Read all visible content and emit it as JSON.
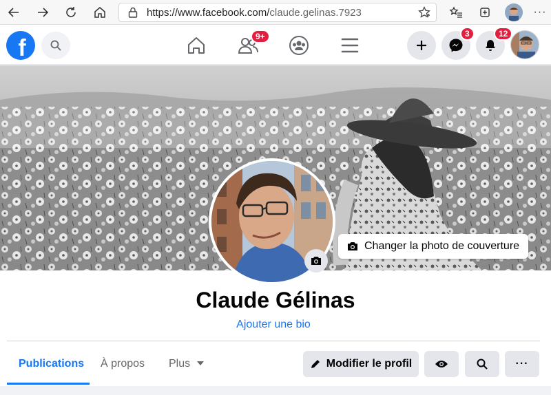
{
  "browser": {
    "url_domain": "https://www.facebook.com/",
    "url_path": "claude.gelinas.7923",
    "menu_glyph": "···"
  },
  "nav": {
    "logo_letter": "f",
    "friends_badge": "9+",
    "messenger_badge": "3",
    "notifications_badge": "12",
    "brand_color": "#1877f2",
    "badge_color": "#e41e3f"
  },
  "cover": {
    "change_cover_label": "Changer la photo de couverture"
  },
  "profile": {
    "name": "Claude Gélinas",
    "add_bio": "Ajouter une bio"
  },
  "tabs": [
    {
      "label": "Publications",
      "active": true
    },
    {
      "label": "À propos",
      "active": false
    },
    {
      "label": "Plus",
      "active": false
    }
  ],
  "actions": {
    "edit_profile": "Modifier le profil",
    "more_glyph": "···"
  }
}
